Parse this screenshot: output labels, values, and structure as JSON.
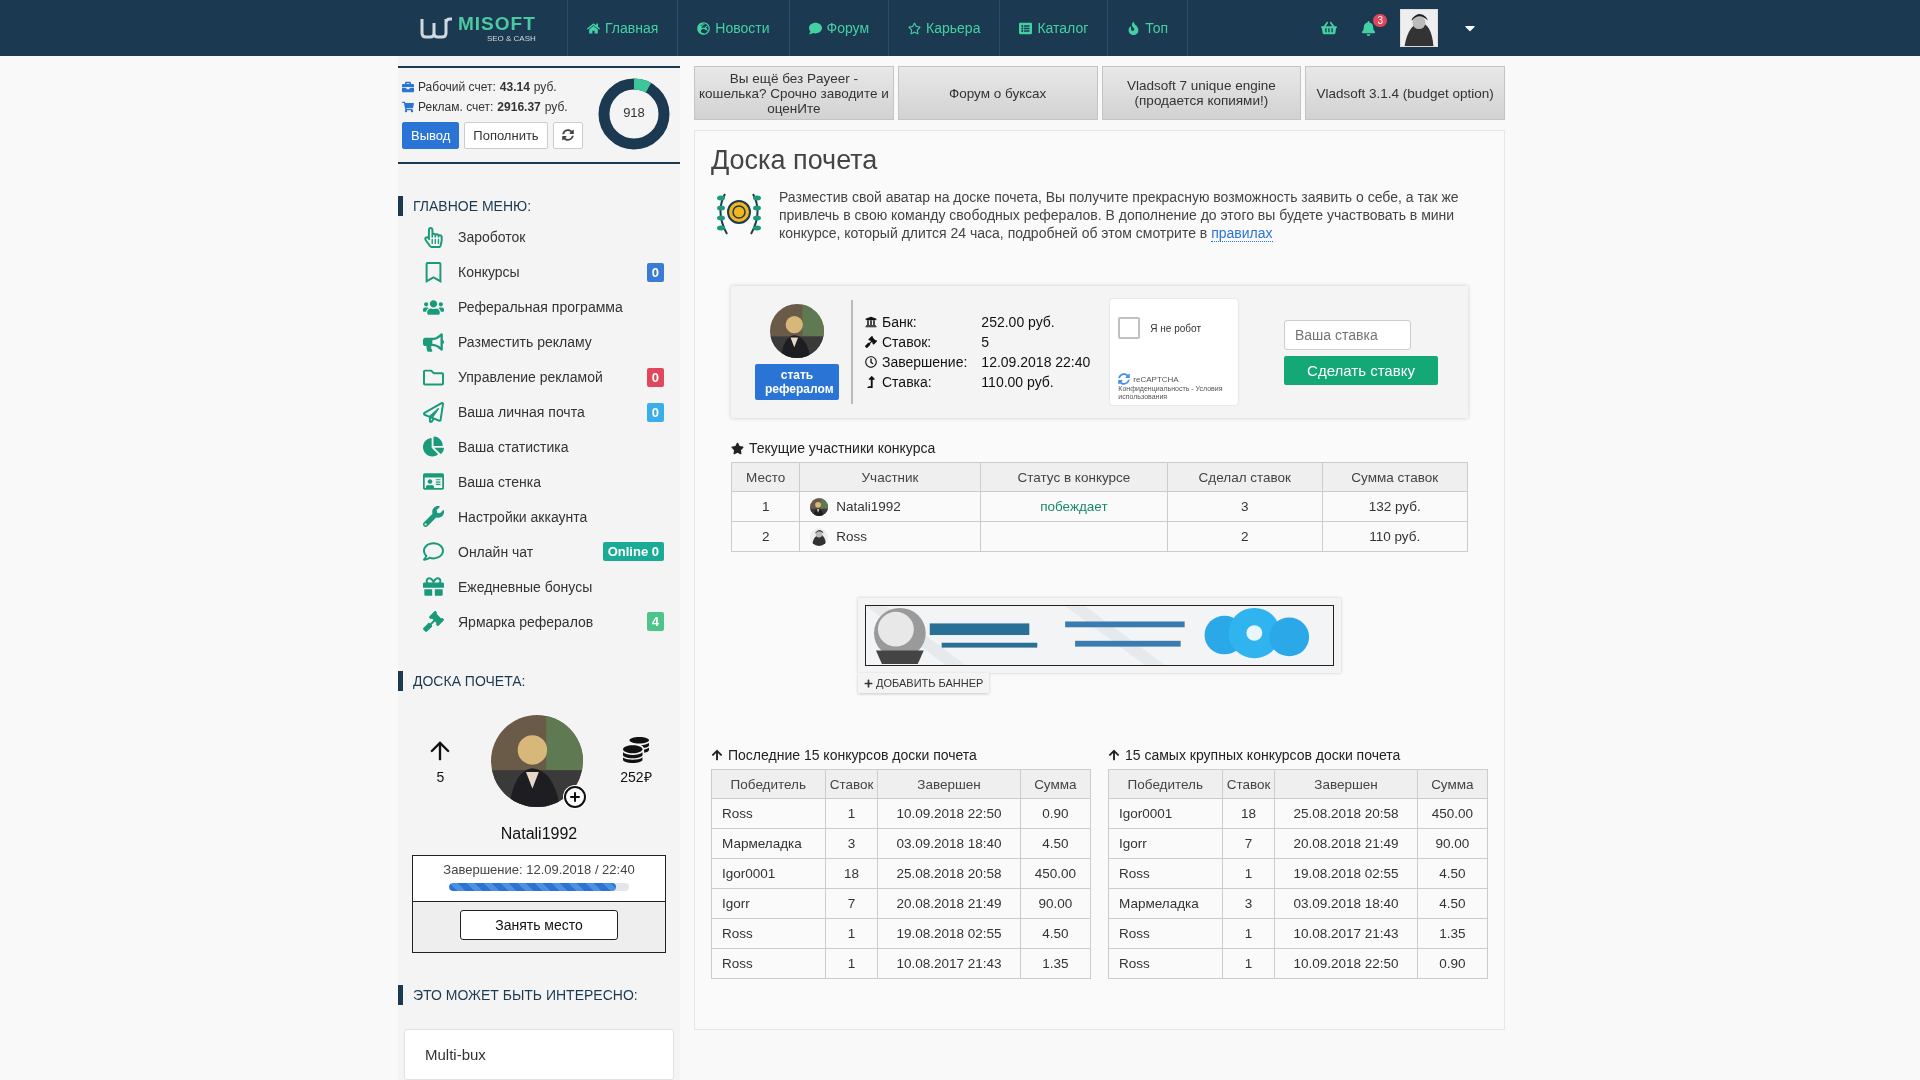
{
  "nav": {
    "logo": "MISOFT",
    "logo_sub": "SEO & CASH",
    "items": [
      "Главная",
      "Новости",
      "Форум",
      "Карьера",
      "Каталог",
      "Топ"
    ],
    "notifications": "3"
  },
  "account": {
    "work_label": "Рабочий счет:",
    "work_value": "43.14",
    "work_unit": "руб.",
    "ad_label": "Реклам. счет:",
    "ad_value": "2916.37",
    "ad_unit": "руб.",
    "withdraw": "Вывод",
    "topup": "Пополнить",
    "score": "918",
    "level": 0.08
  },
  "menu": {
    "title": "ГЛАВНОЕ МЕНЮ:",
    "items": [
      {
        "label": "Зароботок"
      },
      {
        "label": "Конкурсы",
        "badge": "0",
        "color": "#3a7bd5"
      },
      {
        "label": "Реферальная программа"
      },
      {
        "label": "Разместить рекламу"
      },
      {
        "label": "Управление рекламой",
        "badge": "0",
        "color": "#e0475b"
      },
      {
        "label": "Ваша личная почта",
        "badge": "0",
        "color": "#3aaee8"
      },
      {
        "label": "Ваша статистика"
      },
      {
        "label": "Ваша стенка"
      },
      {
        "label": "Настройки аккаунта"
      },
      {
        "label": "Онлайн чат",
        "badge": "Online 0",
        "color": "#1aab95"
      },
      {
        "label": "Ежедневные бонусы"
      },
      {
        "label": "Ярмарка рефералов",
        "badge": "4",
        "color": "#4cc48a"
      }
    ]
  },
  "board": {
    "title": "ДОСКА ПОЧЕТА:",
    "bids": "5",
    "bank": "252₽",
    "name": "Natali1992",
    "ends": "Завершение: 12.09.2018 / 22:40",
    "level": 0.93,
    "button": "Занять место"
  },
  "interesting": {
    "title": "ЭТО МОЖЕТ БЫТЬ ИНТЕРЕСНО:",
    "items": [
      "Multi-bux"
    ]
  },
  "quick_links": [
    "Вы ещё без Payeer - кошелька? Срочно заводите и оценИте",
    "Форум о буксах",
    "Vladsoft 7 unique engine (продается копиями!)",
    "Vladsoft 3.1.4 (budget option)"
  ],
  "page": {
    "title": "Доска почета",
    "intro": "Разместив свой аватар на доске почета, Вы получите прекрасную возможность заявить о себе, а так же привлечь в свою команду свободных рефералов. В дополнение до этого вы будете участвовать в мини конкурсе, который длится 24 часа, подробней об этом смотрите в",
    "intro_link": "правилах"
  },
  "auction": {
    "refer_button": "стать рефералом",
    "rows": [
      {
        "label": "Банк:",
        "value": "252.00 руб."
      },
      {
        "label": "Ставок:",
        "value": "5"
      },
      {
        "label": "Завершение:",
        "value": "12.09.2018 22:40"
      },
      {
        "label": "Ставка:",
        "value": "110.00 руб."
      }
    ],
    "captcha": {
      "label": "Я не робот",
      "checked": false,
      "brand": "reCAPTCHA",
      "terms": "Конфиденциальность - Условия использования"
    },
    "bid_placeholder": "Ваша ставка",
    "bid_button": "Сделать ставку"
  },
  "participants": {
    "title": "Текущие участники конкурса",
    "columns": [
      "Место",
      "Участник",
      "Статус в конкурсе",
      "Сделал ставок",
      "Сумма ставок"
    ],
    "rows": [
      {
        "place": "1",
        "name": "Natali1992",
        "status": "побеждает",
        "bids": "3",
        "sum": "132 руб."
      },
      {
        "place": "2",
        "name": "Ross",
        "bids": "2",
        "sum": "110 руб."
      }
    ]
  },
  "banner": {
    "kind": "picture",
    "add_label": "ДОБАВИТЬ БАННЕР"
  },
  "history": [
    {
      "title": "Последние 15 конкурсов доски почета",
      "columns": [
        "Победитель",
        "Ставок",
        "Завершен",
        "Сумма"
      ],
      "rows": [
        [
          "Ross",
          "1",
          "10.09.2018 22:50",
          "0.90"
        ],
        [
          "Мармеладка",
          "3",
          "03.09.2018 18:40",
          "4.50"
        ],
        [
          "Igor0001",
          "18",
          "25.08.2018 20:58",
          "450.00"
        ],
        [
          "Igorr",
          "7",
          "20.08.2018 21:49",
          "90.00"
        ],
        [
          "Ross",
          "1",
          "19.08.2018 02:55",
          "4.50"
        ],
        [
          "Ross",
          "1",
          "10.08.2017 21:43",
          "1.35"
        ]
      ]
    },
    {
      "title": "15 самых крупных конкурсов доски почета",
      "columns": [
        "Победитель",
        "Ставок",
        "Завершен",
        "Сумма"
      ],
      "rows": [
        [
          "Igor0001",
          "18",
          "25.08.2018 20:58",
          "450.00"
        ],
        [
          "Igorr",
          "7",
          "20.08.2018 21:49",
          "90.00"
        ],
        [
          "Ross",
          "1",
          "19.08.2018 02:55",
          "4.50"
        ],
        [
          "Мармеладка",
          "3",
          "03.09.2018 18:40",
          "4.50"
        ],
        [
          "Ross",
          "1",
          "10.08.2017 21:43",
          "1.35"
        ],
        [
          "Ross",
          "1",
          "10.09.2018 22:50",
          "0.90"
        ]
      ]
    }
  ]
}
